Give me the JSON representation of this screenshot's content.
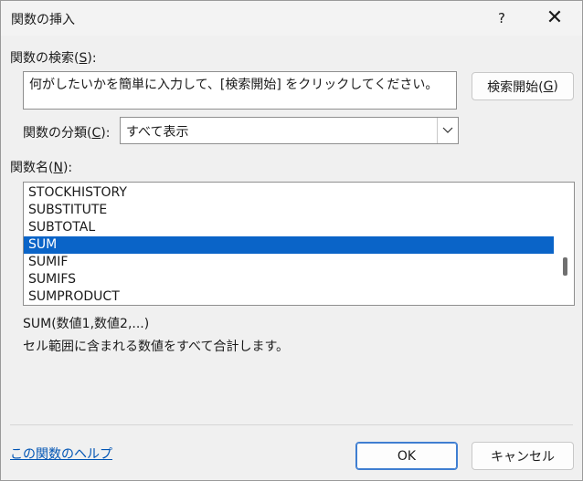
{
  "window": {
    "title": "関数の挿入",
    "help_glyph": "?",
    "close_glyph": "✕"
  },
  "search": {
    "label_pre": "関数の検索(",
    "label_key": "S",
    "label_post": "):",
    "value": "何がしたいかを簡単に入力して、[検索開始] をクリックしてください。",
    "button_pre": "検索開始(",
    "button_key": "G",
    "button_post": ")"
  },
  "category": {
    "label_pre": "関数の分類(",
    "label_key": "C",
    "label_post": "):",
    "selected": "すべて表示",
    "arrow_glyph": "⌵"
  },
  "function_list": {
    "label_pre": "関数名(",
    "label_key": "N",
    "label_post": "):",
    "items": [
      "STOCKHISTORY",
      "SUBSTITUTE",
      "SUBTOTAL",
      "SUM",
      "SUMIF",
      "SUMIFS",
      "SUMPRODUCT"
    ],
    "selected_index": 3
  },
  "description": {
    "syntax": "SUM(数値1,数値2,...)",
    "text": "セル範囲に含まれる数値をすべて合計します。"
  },
  "footer": {
    "help_link": "この関数のヘルプ",
    "ok": "OK",
    "cancel": "キャンセル"
  }
}
